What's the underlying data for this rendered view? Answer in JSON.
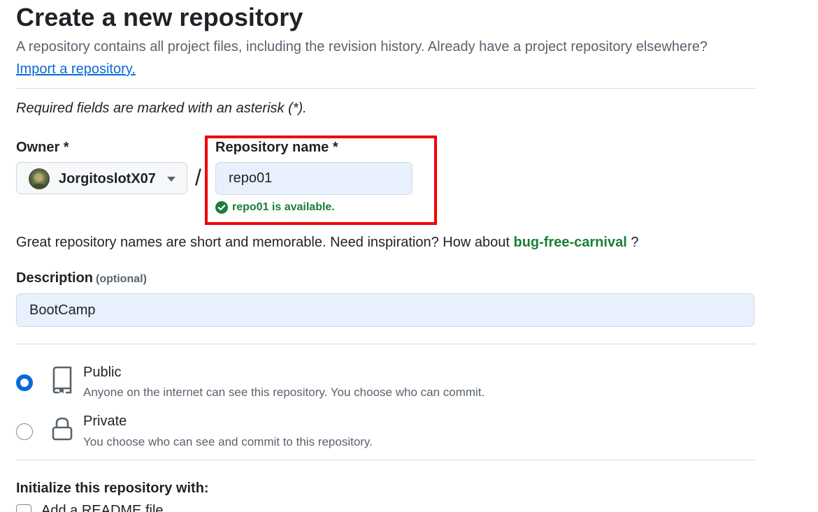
{
  "header": {
    "title": "Create a new repository",
    "subtitle": "A repository contains all project files, including the revision history. Already have a project repository elsewhere?",
    "import_link": "Import a repository."
  },
  "required_note": "Required fields are marked with an asterisk (*).",
  "owner": {
    "label": "Owner *",
    "value": "JorgitoslotX07"
  },
  "separator": "/",
  "repository_name": {
    "label": "Repository name *",
    "value": "repo01",
    "availability": "repo01 is available."
  },
  "name_hint": {
    "text": "Great repository names are short and memorable. Need inspiration? How about",
    "suggestion": "bug-free-carnival",
    "suffix": "?"
  },
  "description": {
    "label": "Description",
    "optional": "(optional)",
    "value": "BootCamp"
  },
  "visibility": {
    "selected": "public",
    "options": [
      {
        "key": "public",
        "icon": "repo-icon",
        "title": "Public",
        "description": "Anyone on the internet can see this repository. You choose who can commit."
      },
      {
        "key": "private",
        "icon": "lock-icon",
        "title": "Private",
        "description": "You choose who can see and commit to this repository."
      }
    ]
  },
  "initialize": {
    "title": "Initialize this repository with:",
    "readme_label": "Add a README file"
  },
  "colors": {
    "accent": "#0969da",
    "success": "#1a7f37",
    "highlight": "#ee0000",
    "autofill_bg": "#e8f0fe"
  }
}
